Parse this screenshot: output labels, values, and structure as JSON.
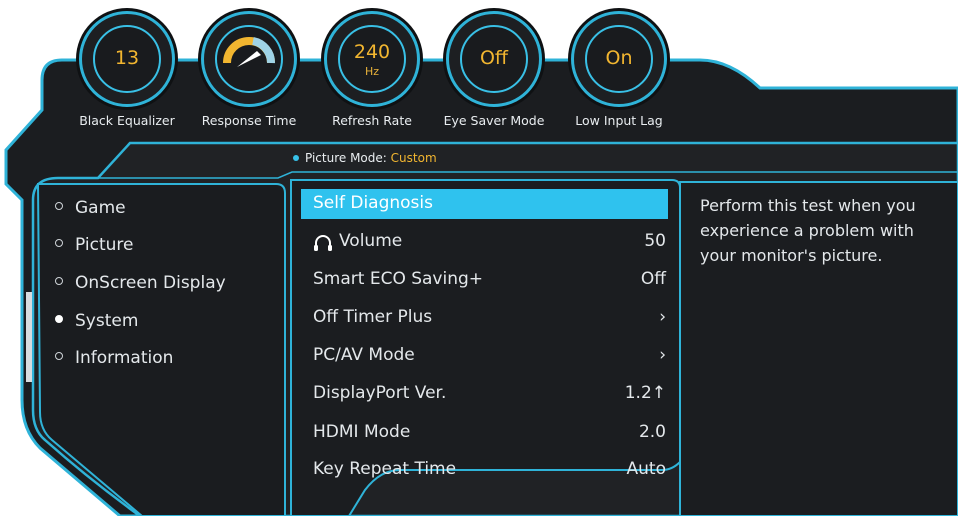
{
  "dials": [
    {
      "value": "13",
      "unit": "",
      "label": "Black Equalizer"
    },
    {
      "value": "",
      "unit": "",
      "label": "Response Time",
      "icon": "speedometer-icon"
    },
    {
      "value": "240",
      "unit": "Hz",
      "label": "Refresh Rate"
    },
    {
      "value": "Off",
      "unit": "",
      "label": "Eye Saver Mode"
    },
    {
      "value": "On",
      "unit": "",
      "label": "Low Input Lag"
    }
  ],
  "picture_mode": {
    "label": "Picture Mode:",
    "value": "Custom"
  },
  "categories": [
    {
      "label": "Game",
      "active": false
    },
    {
      "label": "Picture",
      "active": false
    },
    {
      "label": "OnScreen Display",
      "active": false
    },
    {
      "label": "System",
      "active": true
    },
    {
      "label": "Information",
      "active": false
    }
  ],
  "menu_items": [
    {
      "label": "Self Diagnosis",
      "value": "",
      "selected": true
    },
    {
      "label": "Volume",
      "value": "50",
      "icon": "headphones-icon"
    },
    {
      "label": "Smart ECO Saving+",
      "value": "Off"
    },
    {
      "label": "Off Timer Plus",
      "value": "›"
    },
    {
      "label": "PC/AV Mode",
      "value": "›"
    },
    {
      "label": "DisplayPort Ver.",
      "value": "1.2↑"
    },
    {
      "label": "HDMI Mode",
      "value": "2.0"
    },
    {
      "label": "Key Repeat Time",
      "value": "Auto"
    }
  ],
  "help_text": "Perform this test when you experience a problem with your monitor's picture.",
  "colors": {
    "accent": "#2fc2ee",
    "value": "#f2b630",
    "panel": "#1d1f22",
    "outline": "#2fb3d8"
  }
}
